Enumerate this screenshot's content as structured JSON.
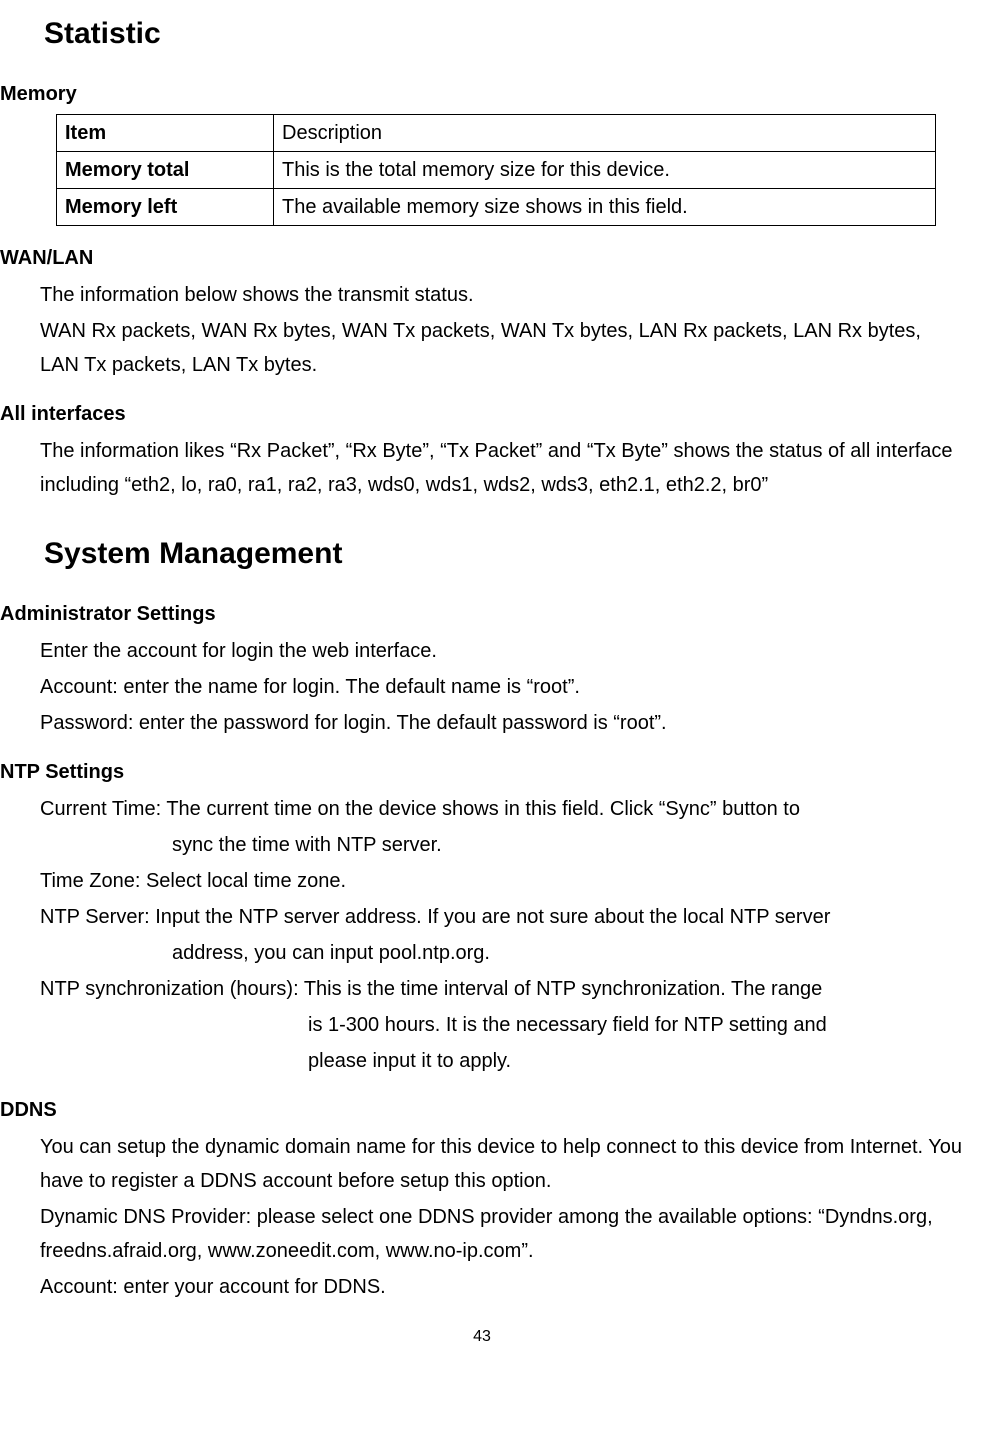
{
  "headings": {
    "statistic": "Statistic",
    "memory": "Memory",
    "wanlan": "WAN/LAN",
    "all_interfaces": "All interfaces",
    "system_management": "System Management",
    "admin_settings": "Administrator Settings",
    "ntp_settings": "NTP Settings",
    "ddns": "DDNS"
  },
  "memory_table": {
    "header_item": "Item",
    "header_desc": "Description",
    "row1_item": "Memory total",
    "row1_desc": "This is the total memory size for this device.",
    "row2_item": "Memory left",
    "row2_desc": "The available memory size shows in this field."
  },
  "wanlan": {
    "line1": "The information below shows the transmit status.",
    "line2": "WAN Rx packets, WAN Rx bytes, WAN Tx packets, WAN Tx bytes, LAN Rx packets, LAN Rx bytes, LAN Tx packets, LAN Tx bytes."
  },
  "all_interfaces": {
    "text": "The information likes “Rx Packet”, “Rx Byte”, “Tx Packet” and “Tx Byte” shows the status of all interface including “eth2, lo, ra0, ra1, ra2, ra3, wds0, wds1, wds2, wds3, eth2.1, eth2.2, br0”"
  },
  "admin": {
    "line1": "Enter the account for login the web interface.",
    "line2": "Account: enter the name for login. The default name is “root”.",
    "line3": "Password: enter the password for login. The default password is “root”."
  },
  "ntp": {
    "ct_line1": "Current Time: The current time on the device shows in this field. Click “Sync” button to",
    "ct_line2": "sync the time with NTP server.",
    "tz": "Time Zone: Select local time zone.",
    "srv_line1": "NTP Server: Input the NTP server address. If you are not sure about the local NTP server",
    "srv_line2": "address, you can input pool.ntp.org.",
    "sync_line1": "NTP synchronization (hours): This is the time interval of NTP synchronization. The range",
    "sync_line2": "is 1-300 hours. It is the necessary field for NTP setting and",
    "sync_line3": "please input it to apply."
  },
  "ddns": {
    "line1": "You can setup the dynamic domain name for this device to help connect to this device from Internet. You have to register a DDNS account before setup this option.",
    "line2": "Dynamic DNS Provider: please select one DDNS provider among the available options: “Dyndns.org, freedns.afraid.org, www.zoneedit.com, www.no-ip.com”.",
    "line3": "Account: enter your account for DDNS."
  },
  "page_number": "43"
}
